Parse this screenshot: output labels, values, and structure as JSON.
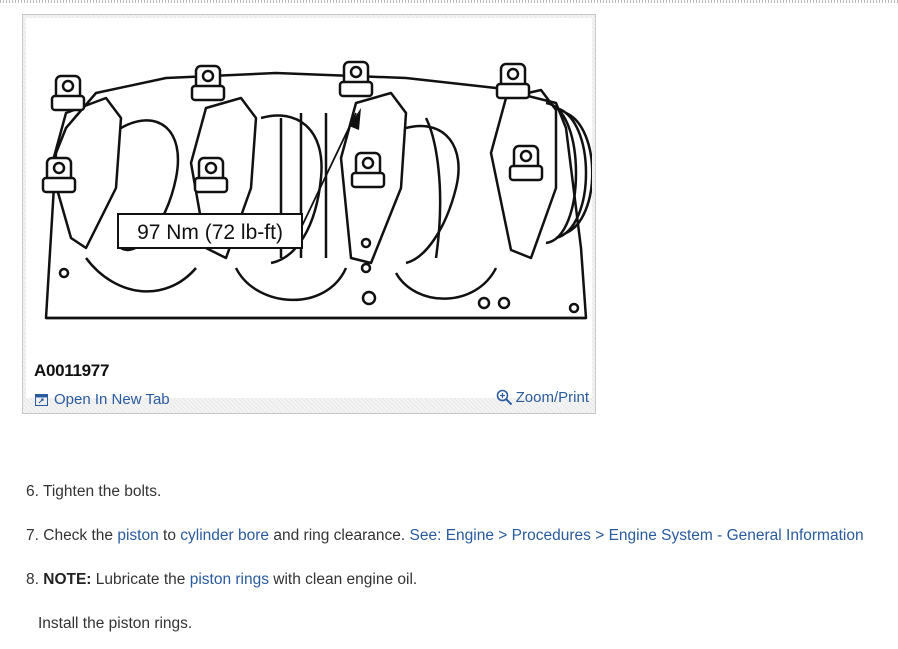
{
  "figure": {
    "torque_label": "97 Nm (72 lb-ft)",
    "code": "A0011977",
    "open_tab_label": "Open In New Tab",
    "zoom_label": "Zoom/Print",
    "icons": {
      "open": "open-new-tab-icon",
      "zoom": "magnifier-icon"
    }
  },
  "steps": [
    {
      "num": "6.",
      "text": "Tighten the bolts."
    },
    {
      "num": "7.",
      "pre": "Check the",
      "link1": "piston",
      "mid1": "to",
      "link2": "cylinder bore",
      "mid2": "and ring clearance.",
      "link3": "See: Engine > Procedures > Engine System - General Information"
    },
    {
      "num": "8.",
      "note_label": "NOTE:",
      "note_pre": "Lubricate the",
      "note_link": "piston rings",
      "note_post": "with clean engine oil.",
      "sub": "Install the piston rings."
    }
  ],
  "colors": {
    "link": "#2a5b9e",
    "text": "#333333"
  }
}
